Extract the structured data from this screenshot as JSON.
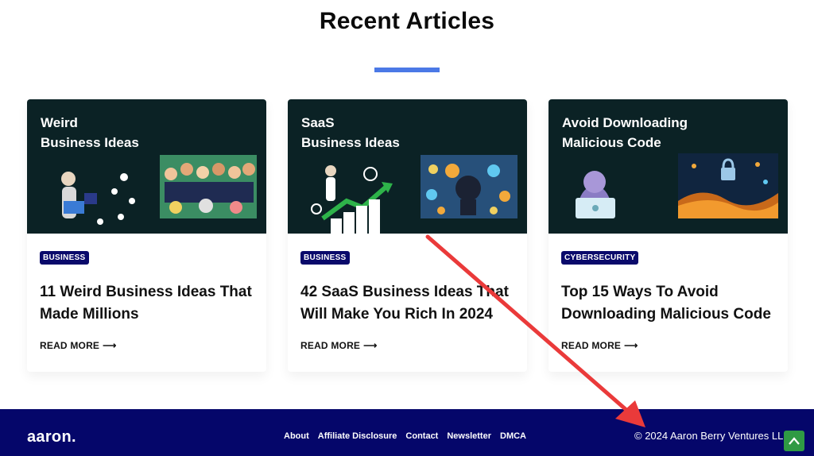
{
  "section": {
    "title": "Recent Articles"
  },
  "articles": [
    {
      "thumb_lines": [
        "Weird",
        "Business Ideas"
      ],
      "category": "BUSINESS",
      "title": "11 Weird Business Ideas That Made Millions",
      "read_more": "READ MORE"
    },
    {
      "thumb_lines": [
        "SaaS",
        "Business Ideas"
      ],
      "category": "BUSINESS",
      "title": "42 SaaS Business Ideas That Will Make You Rich In 2024",
      "read_more": "READ MORE"
    },
    {
      "thumb_lines": [
        "Avoid Downloading",
        "Malicious Code"
      ],
      "category": "CYBERSECURITY",
      "title": "Top 15 Ways To Avoid Downloading Malicious Code",
      "read_more": "READ MORE"
    }
  ],
  "footer": {
    "logo": "aaron.",
    "nav": [
      "About",
      "Affiliate Disclosure",
      "Contact",
      "Newsletter",
      "DMCA"
    ],
    "copyright": "© 2024 Aaron Berry Ventures LLC"
  },
  "colors": {
    "accent_rule": "#4b79e6",
    "badge": "#0a0a6b",
    "footer": "#05066a",
    "thumb_bg": "#0b2225",
    "annotation": "#ea3a3a",
    "to_top": "#2f9a44"
  },
  "icons": [
    "arrow-right-icon",
    "chevron-up-icon"
  ]
}
